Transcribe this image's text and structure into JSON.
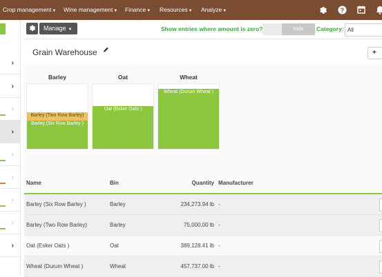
{
  "nav": {
    "menus": [
      "Crop management",
      "Wine management",
      "Finance",
      "Resources",
      "Analyze"
    ],
    "icons": [
      "gear-icon",
      "help-icon",
      "calendar-icon",
      "bell-icon"
    ]
  },
  "toolbar": {
    "manage_label": "Manage",
    "zero_label": "Show entries where amount is zero?",
    "zero_toggle_label": "Hide",
    "category_label": "Category:",
    "category_value": "All"
  },
  "warehouse": {
    "title": "Grain Warehouse",
    "add_label": "+"
  },
  "bins": [
    {
      "title": "Barley",
      "segments": [
        {
          "label": "Barley (Two Row Barley)",
          "color": "#f0c060",
          "fraction": 0.13
        },
        {
          "label": "Barley (Six Row Barley )",
          "color": "#8cc63f",
          "fraction": 0.44
        }
      ]
    },
    {
      "title": "Oat",
      "segments": [
        {
          "label": "Oat (Esker Oats )",
          "color": "#8cc63f",
          "fraction": 0.66
        }
      ]
    },
    {
      "title": "Wheat",
      "segments": [
        {
          "label": "Wheat (Durum Wheat )",
          "color": "#8cc63f",
          "fraction": 0.93
        }
      ]
    }
  ],
  "table": {
    "headers": {
      "name": "Name",
      "bin": "Bin",
      "quantity": "Quantity",
      "manufacturer": "Manufacturer"
    },
    "rows": [
      {
        "name": "Barley (Six Row Barley )",
        "bin": "Barley",
        "quantity": "234,273.94 lb",
        "manufacturer": "-"
      },
      {
        "name": "Barley (Two Row Barley)",
        "bin": "Barley",
        "quantity": "75,000.00 lb",
        "manufacturer": "-"
      },
      {
        "name": "Oat (Esker Oats )",
        "bin": "Oat",
        "quantity": "389,128.41 lb",
        "manufacturer": "-"
      },
      {
        "name": "Wheat (Durum Wheat )",
        "bin": "Wheat",
        "quantity": "457,737.00 lb",
        "manufacturer": "-"
      }
    ]
  }
}
